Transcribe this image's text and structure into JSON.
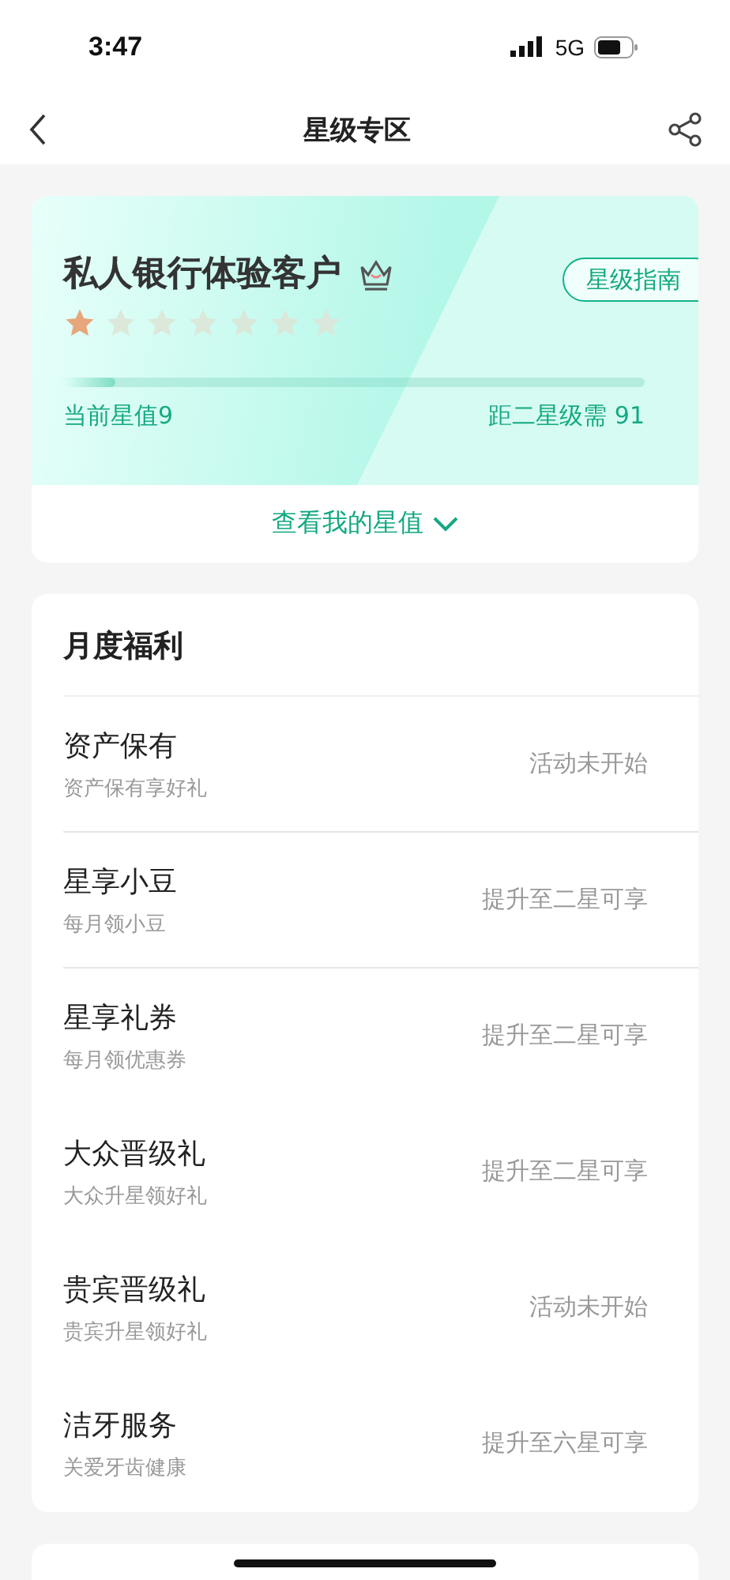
{
  "status_bar": {
    "time": "3:47",
    "network": "5G"
  },
  "nav": {
    "title": "星级专区"
  },
  "star_card": {
    "title": "私人银行体验客户",
    "guide_button": "星级指南",
    "stars": 1,
    "level": 0.09,
    "current_value": "当前星值9",
    "next_level": "距二星级需 91",
    "expand_link": "查看我的星值"
  },
  "benefits": {
    "title": "月度福利",
    "items": [
      {
        "name": "资产保有",
        "desc": "资产保有享好礼",
        "status": "活动未开始",
        "divider": true
      },
      {
        "name": "星享小豆",
        "desc": "每月领小豆",
        "status": "提升至二星可享",
        "divider": true
      },
      {
        "name": "星享礼券",
        "desc": "每月领优惠券",
        "status": "提升至二星可享",
        "divider": false
      },
      {
        "name": "大众晋级礼",
        "desc": "大众升星领好礼",
        "status": "提升至二星可享",
        "divider": false
      },
      {
        "name": "贵宾晋级礼",
        "desc": "贵宾升星领好礼",
        "status": "活动未开始",
        "divider": false
      },
      {
        "name": "洁牙服务",
        "desc": "关爱牙齿健康",
        "status": "提升至六星可享",
        "divider": false
      }
    ]
  }
}
